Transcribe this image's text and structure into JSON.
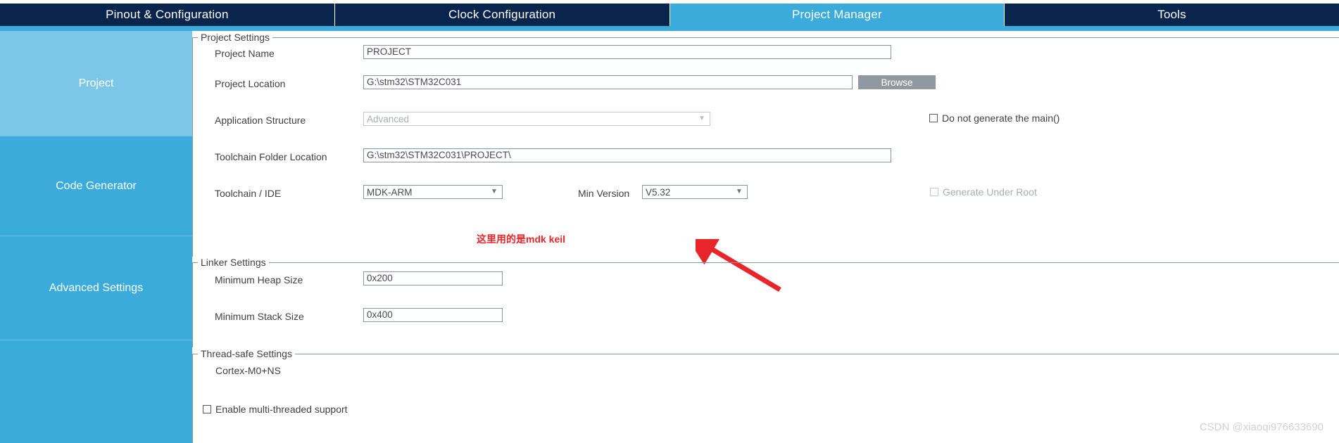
{
  "tabs": [
    {
      "label": "Pinout & Configuration",
      "active": false
    },
    {
      "label": "Clock Configuration",
      "active": false
    },
    {
      "label": "Project Manager",
      "active": true
    },
    {
      "label": "Tools",
      "active": false
    }
  ],
  "sidebar": {
    "items": [
      {
        "label": "Project",
        "active": true
      },
      {
        "label": "Code Generator",
        "active": false
      },
      {
        "label": "Advanced Settings",
        "active": false
      },
      {
        "label": "",
        "active": false
      }
    ]
  },
  "project_settings": {
    "title": "Project Settings",
    "project_name_label": "Project Name",
    "project_name_value": "PROJECT",
    "project_location_label": "Project Location",
    "project_location_value": "G:\\stm32\\STM32C031",
    "browse_label": "Browse",
    "application_structure_label": "Application Structure",
    "application_structure_value": "Advanced",
    "do_not_generate_main_label": "Do not generate the main()",
    "do_not_generate_main_checked": false,
    "toolchain_folder_label": "Toolchain Folder Location",
    "toolchain_folder_value": "G:\\stm32\\STM32C031\\PROJECT\\",
    "toolchain_ide_label": "Toolchain / IDE",
    "toolchain_ide_value": "MDK-ARM",
    "min_version_label": "Min Version",
    "min_version_value": "V5.32",
    "generate_under_root_label": "Generate Under Root",
    "generate_under_root_checked": false
  },
  "linker_settings": {
    "title": "Linker Settings",
    "min_heap_label": "Minimum Heap Size",
    "min_heap_value": "0x200",
    "min_stack_label": "Minimum Stack Size",
    "min_stack_value": "0x400"
  },
  "thread_safe_settings": {
    "title": "Thread-safe Settings",
    "core_label": "Cortex-M0+NS",
    "enable_multithread_label": "Enable multi-threaded support",
    "enable_multithread_checked": false
  },
  "annotation": {
    "text": "这里用的是mdk keil",
    "color": "#e8262a"
  },
  "watermark": "CSDN @xiaoqi976633690",
  "colors": {
    "tabbar_bg": "#09254d",
    "accent": "#3aabda",
    "sidebar_active": "#7cc6e8",
    "button_gray": "#9099a1",
    "border": "#8b95a0"
  }
}
